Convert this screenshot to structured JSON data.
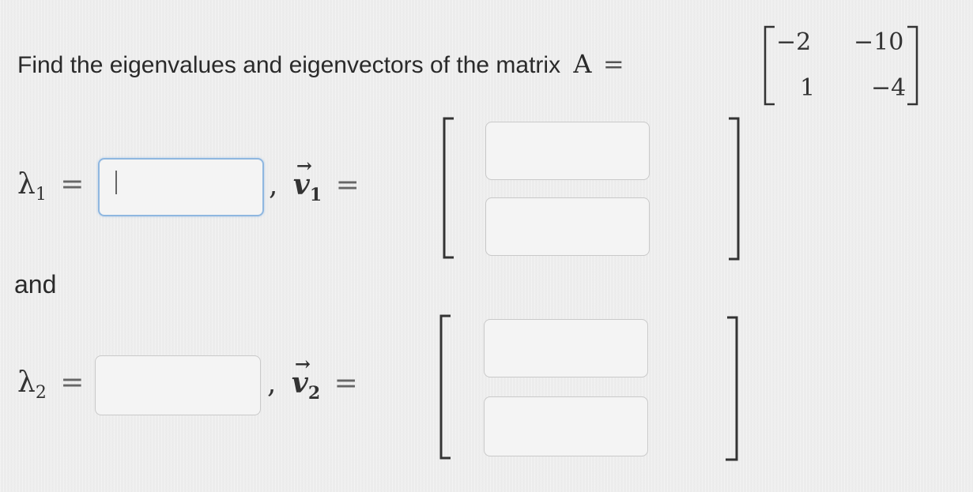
{
  "question": {
    "text": "Find the eigenvalues and eigenvectors of the matrix",
    "matrix_symbol": "A",
    "equals": "=",
    "matrix": [
      [
        "−2",
        "−10"
      ],
      [
        "1",
        "−4"
      ]
    ]
  },
  "row1": {
    "lambda_label": "λ",
    "lambda_sub": "1",
    "equals": "=",
    "comma": ",",
    "v_label": "v",
    "v_sub": "1",
    "v_equals": "=",
    "lambda_value": "",
    "v_entries": [
      "",
      ""
    ]
  },
  "connector": "and",
  "row2": {
    "lambda_label": "λ",
    "lambda_sub": "2",
    "equals": "=",
    "comma": ",",
    "v_label": "v",
    "v_sub": "2",
    "v_equals": "=",
    "lambda_value": "",
    "v_entries": [
      "",
      ""
    ]
  }
}
